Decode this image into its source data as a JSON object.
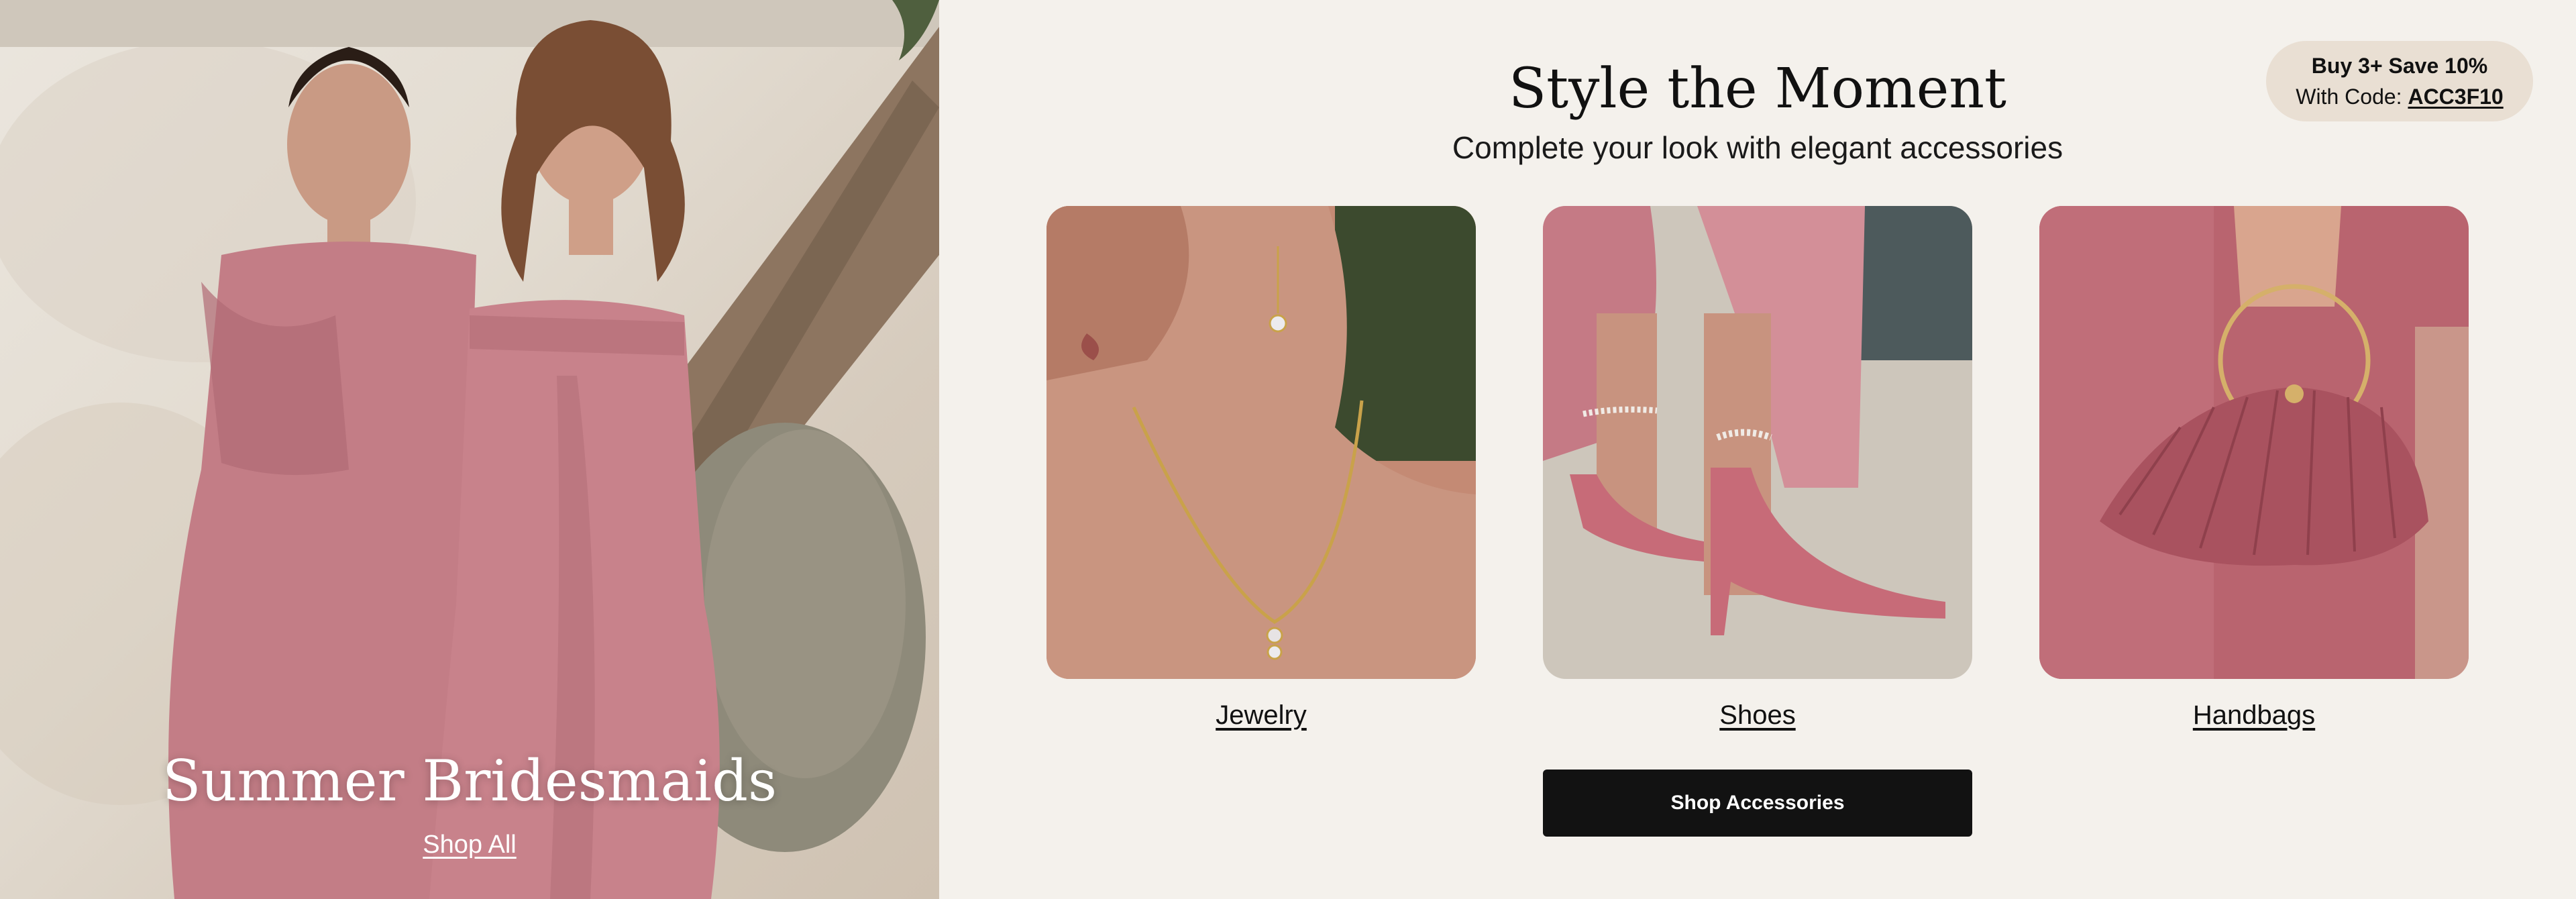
{
  "hero": {
    "title": "Summer Bridesmaids",
    "link_label": "Shop All",
    "dress_color": "#c37d86"
  },
  "panel": {
    "title": "Style the Moment",
    "subtitle": "Complete your look with elegant accessories",
    "promo": {
      "line1": "Buy 3+ Save 10%",
      "line2_prefix": "With Code: ",
      "code": "ACC3F10"
    },
    "categories": [
      {
        "label": "Jewelry"
      },
      {
        "label": "Shoes"
      },
      {
        "label": "Handbags"
      }
    ],
    "cta_label": "Shop Accessories"
  },
  "colors": {
    "background": "#f4f1ec",
    "accent_rose": "#b9646f",
    "cta_background": "#121212",
    "promo_background": "#e9dfd3"
  }
}
